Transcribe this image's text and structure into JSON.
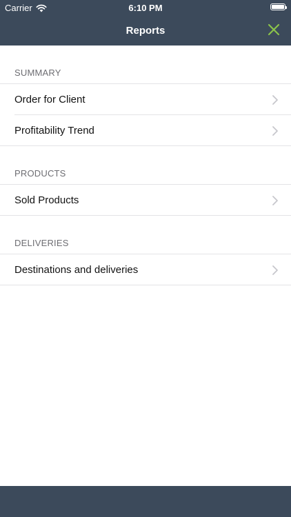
{
  "status_bar": {
    "carrier": "Carrier",
    "time": "6:10 PM"
  },
  "nav": {
    "title": "Reports",
    "close_icon": "close-icon",
    "close_color": "#8bc34a"
  },
  "colors": {
    "bar_background": "#3c4a5b",
    "section_text": "#6d6d72",
    "separator": "#e3e3e6"
  },
  "sections": [
    {
      "header": "SUMMARY",
      "items": [
        {
          "label": "Order for Client"
        },
        {
          "label": "Profitability Trend"
        }
      ]
    },
    {
      "header": "PRODUCTS",
      "items": [
        {
          "label": "Sold Products"
        }
      ]
    },
    {
      "header": "DELIVERIES",
      "items": [
        {
          "label": "Destinations and deliveries"
        }
      ]
    }
  ]
}
